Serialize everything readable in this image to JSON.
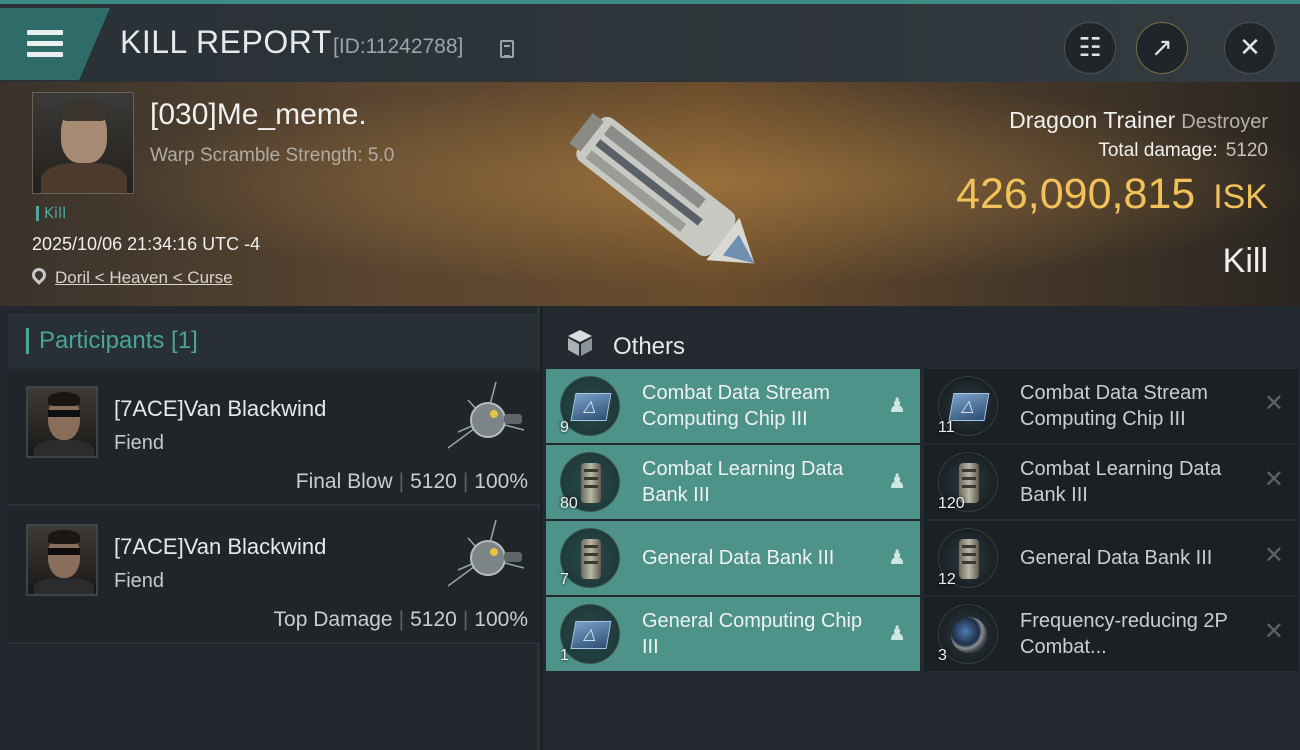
{
  "header": {
    "title": "KILL REPORT",
    "report_id": "[ID:11242788]",
    "icons": [
      "menu-icon",
      "copy-icon",
      "clipboard-icon",
      "share-icon",
      "close-icon"
    ],
    "accent_color": "#3e8a84"
  },
  "victim": {
    "name": "[030]Me_meme.",
    "warp_scramble": "Warp Scramble Strength: 5.0",
    "tag": "Kill",
    "datetime": "2025/10/06 21:34:16 UTC -4",
    "location": "Doril < Heaven < Curse"
  },
  "ship": {
    "name": "Dragoon Trainer",
    "class": "Destroyer",
    "total_damage_label": "Total damage:",
    "total_damage": "5120",
    "isk_value": "426,090,815",
    "isk_unit": "ISK",
    "result": "Kill",
    "isk_color": "#f2c25a"
  },
  "participants": {
    "title": "Participants [1]",
    "rows": [
      {
        "name": "[7ACE]Van Blackwind",
        "ship": "Fiend",
        "role": "Final Blow",
        "damage": "5120",
        "percent": "100%"
      },
      {
        "name": "[7ACE]Van Blackwind",
        "ship": "Fiend",
        "role": "Top Damage",
        "damage": "5120",
        "percent": "100%"
      }
    ]
  },
  "others": {
    "title": "Others",
    "dropped": [
      {
        "name": "Combat Data Stream Computing Chip III",
        "qty": "9",
        "icon": "chip-icon"
      },
      {
        "name": "Combat Learning Data Bank III",
        "qty": "80",
        "icon": "data-bank-icon"
      },
      {
        "name": "General Data Bank III",
        "qty": "7",
        "icon": "data-bank-icon"
      },
      {
        "name": "General Computing Chip III",
        "qty": "1",
        "icon": "chip-icon"
      }
    ],
    "destroyed": [
      {
        "name": "Combat Data Stream Computing Chip III",
        "qty": "11",
        "icon": "chip-icon"
      },
      {
        "name": "Combat Learning Data Bank III",
        "qty": "120",
        "icon": "data-bank-icon"
      },
      {
        "name": "General Data Bank III",
        "qty": "12",
        "icon": "data-bank-icon"
      },
      {
        "name": "Frequency-reducing 2P Combat...",
        "qty": "3",
        "icon": "lens-module-icon"
      }
    ],
    "dropped_color": "#4d9389"
  }
}
